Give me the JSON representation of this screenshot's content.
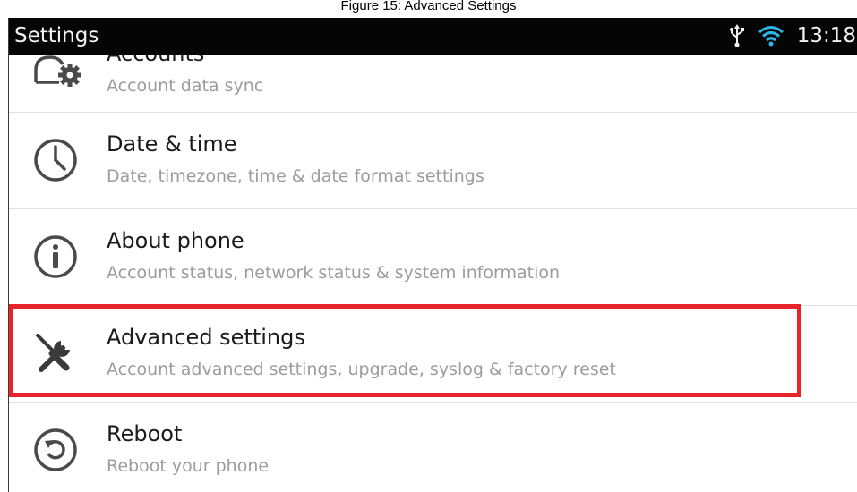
{
  "caption": "Figure 15: Advanced Settings",
  "status_bar": {
    "title": "Settings",
    "time": "13:18",
    "icons": [
      "usb-icon",
      "wifi-icon"
    ]
  },
  "settings_list": [
    {
      "title": "Accounts",
      "subtitle": "Account data sync",
      "icon": "accounts-icon"
    },
    {
      "title": "Date & time",
      "subtitle": "Date, timezone, time & date format settings",
      "icon": "clock-icon"
    },
    {
      "title": "About phone",
      "subtitle": "Account status, network status & system information",
      "icon": "info-icon"
    },
    {
      "title": "Advanced settings",
      "subtitle": "Account advanced settings, upgrade, syslog & factory reset",
      "icon": "tools-icon",
      "highlighted": true
    },
    {
      "title": "Reboot",
      "subtitle": "Reboot your phone",
      "icon": "reboot-icon"
    }
  ],
  "colors": {
    "status_bar_bg": "#050505",
    "highlight": "#e8242b",
    "title_text": "#1a1a1a",
    "subtitle_text": "#9c9c9c"
  }
}
